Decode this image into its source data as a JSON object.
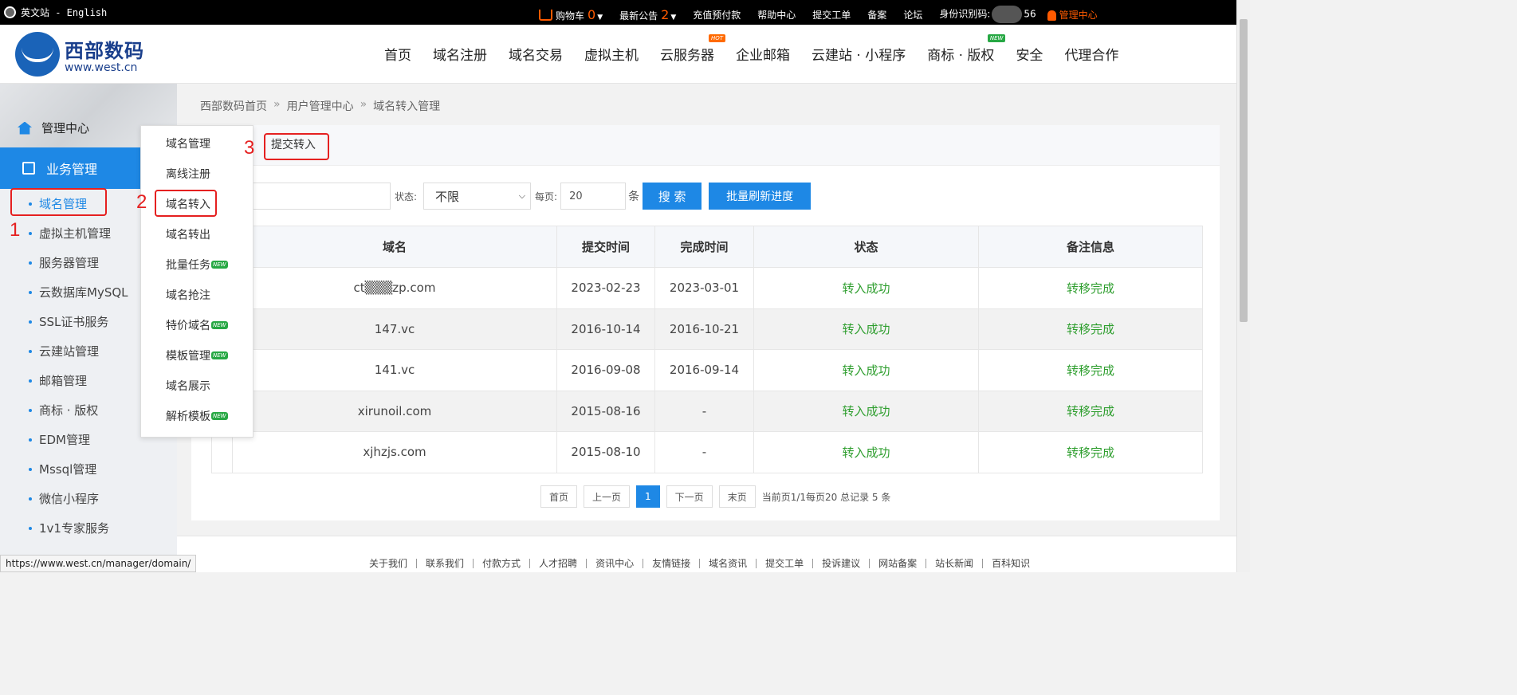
{
  "topbar": {
    "lang": "英文站 - English",
    "cart_label": "购物车",
    "cart_count": "0",
    "notice_label": "最新公告",
    "notice_count": "2",
    "recharge": "充值预付款",
    "help": "帮助中心",
    "ticket": "提交工单",
    "beian": "备案",
    "forum": "论坛",
    "id_label": "身份识别码:",
    "id_suffix": "56",
    "manage_center": "管理中心"
  },
  "header": {
    "logo_cn": "西部数码",
    "logo_en": "www.west.cn",
    "nav": [
      "首页",
      "域名注册",
      "域名交易",
      "虚拟主机",
      "云服务器",
      "企业邮箱",
      "云建站 · 小程序",
      "商标 · 版权",
      "安全",
      "代理合作"
    ],
    "hot_badge": "HOT",
    "new_badge": "NEW"
  },
  "sidebar": {
    "home": "管理中心",
    "business": "业务管理",
    "items": [
      "域名管理",
      "虚拟主机管理",
      "服务器管理",
      "云数据库MySQL",
      "SSL证书服务",
      "云建站管理",
      "邮箱管理",
      "商标 · 版权",
      "EDM管理",
      "Mssql管理",
      "微信小程序",
      "1v1专家服务"
    ]
  },
  "breadcrumb": [
    "西部数码首页",
    "用户管理中心",
    "域名转入管理"
  ],
  "tabs": {
    "submit": "提交转入"
  },
  "search": {
    "status_label": "状态:",
    "status_value": "不限",
    "perpage_label": "每页:",
    "perpage_value": "20",
    "unit": "条",
    "search_btn": "搜 索",
    "refresh_btn": "批量刷新进度"
  },
  "table": {
    "headers": [
      "域名",
      "提交时间",
      "完成时间",
      "状态",
      "备注信息"
    ],
    "rows": [
      [
        "ct▒▒▒zp.com",
        "2023-02-23",
        "2023-03-01",
        "转入成功",
        "转移完成"
      ],
      [
        "147.vc",
        "2016-10-14",
        "2016-10-21",
        "转入成功",
        "转移完成"
      ],
      [
        "141.vc",
        "2016-09-08",
        "2016-09-14",
        "转入成功",
        "转移完成"
      ],
      [
        "xirunoil.com",
        "2015-08-16",
        "-",
        "转入成功",
        "转移完成"
      ],
      [
        "xjhzjs.com",
        "2015-08-10",
        "-",
        "转入成功",
        "转移完成"
      ]
    ]
  },
  "pager": {
    "first": "首页",
    "prev": "上一页",
    "current": "1",
    "next": "下一页",
    "last": "末页",
    "info": "当前页1/1每页20 总记录 5 条"
  },
  "menu": {
    "items": [
      "域名管理",
      "离线注册",
      "域名转入",
      "域名转出",
      "批量任务",
      "域名抢注",
      "特价域名",
      "模板管理",
      "域名展示",
      "解析模板"
    ],
    "new_tag": "NEW"
  },
  "annotations": [
    "1",
    "2",
    "3"
  ],
  "footer": [
    "关于我们",
    "联系我们",
    "付款方式",
    "人才招聘",
    "资讯中心",
    "友情链接",
    "域名资讯",
    "提交工单",
    "投诉建议",
    "网站备案",
    "站长新闻",
    "百科知识"
  ],
  "status_url": "https://www.west.cn/manager/domain/",
  "colors": {
    "accent": "#1e88e5",
    "orange": "#ff5a00",
    "success": "#2e9e2e",
    "annotation": "#e52020"
  }
}
